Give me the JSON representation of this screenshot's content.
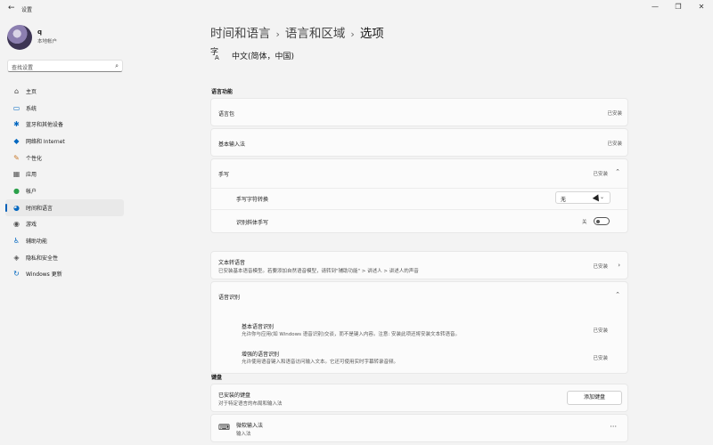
{
  "window": {
    "title": "设置",
    "back": "←",
    "controls": [
      "—",
      "❐",
      "✕"
    ]
  },
  "profile": {
    "name": "q",
    "subtitle": "本地帐户"
  },
  "search": {
    "placeholder": "查找设置"
  },
  "nav": [
    {
      "label": "主页",
      "icon": "home-icon",
      "color": "#444"
    },
    {
      "label": "系统",
      "icon": "system-icon",
      "color": "#0067c0"
    },
    {
      "label": "蓝牙和其他设备",
      "icon": "bluetooth-icon",
      "color": "#0067c0"
    },
    {
      "label": "网络和 Internet",
      "icon": "wifi-icon",
      "color": "#0067c0"
    },
    {
      "label": "个性化",
      "icon": "brush-icon",
      "color": "#c7792b"
    },
    {
      "label": "应用",
      "icon": "apps-icon",
      "color": "#555"
    },
    {
      "label": "帐户",
      "icon": "account-icon",
      "color": "#2aa04a"
    },
    {
      "label": "时间和语言",
      "icon": "globe-clock-icon",
      "color": "#0067c0",
      "active": true
    },
    {
      "label": "游戏",
      "icon": "game-icon",
      "color": "#555"
    },
    {
      "label": "辅助功能",
      "icon": "accessibility-icon",
      "color": "#0067c0"
    },
    {
      "label": "隐私和安全性",
      "icon": "shield-icon",
      "color": "#555"
    },
    {
      "label": "Windows 更新",
      "icon": "update-icon",
      "color": "#0067c0"
    }
  ],
  "breadcrumb": [
    "时间和语言",
    "语言和区域",
    "选项"
  ],
  "language": {
    "name": "中文(简体，中国)"
  },
  "sections": {
    "features_title": "语言功能",
    "keyboard_title": "键盘"
  },
  "features": {
    "language_pack": {
      "label": "语言包",
      "status": "已安装"
    },
    "basic_typing": {
      "label": "基本输入法",
      "status": "已安装"
    },
    "handwriting": {
      "label": "手写",
      "status": "已安装",
      "conversion": {
        "label": "手写字符转换",
        "value": "无"
      },
      "italic": {
        "label": "识别斜体手写",
        "state": "关"
      }
    },
    "tts": {
      "label": "文本转语音",
      "sub": "已安装基本语音模型。若要添加自然语音模型，请转到\"辅助功能\" > 讲述人 > 讲述人的声音",
      "status": "已安装"
    },
    "speech": {
      "label": "语音识别",
      "basic": {
        "label": "基本语音识别",
        "sub": "允许你与应用(如 Windows 语音识别)交谈，而不是键入内容。注意: 安装此项还将安装文本转语音。",
        "status": "已安装"
      },
      "enhanced": {
        "label": "增强的语音识别",
        "sub": "允许使用语音键入和语音访问输入文本。它还可使用实时字幕转录音频。",
        "status": "已安装"
      }
    }
  },
  "keyboard": {
    "installed": {
      "label": "已安装的键盘",
      "sub": "对于特定语言的布局和输入法",
      "button": "添加键盘"
    },
    "ime": {
      "label": "微软输入法",
      "sub": "输入法",
      "more": "···"
    }
  }
}
